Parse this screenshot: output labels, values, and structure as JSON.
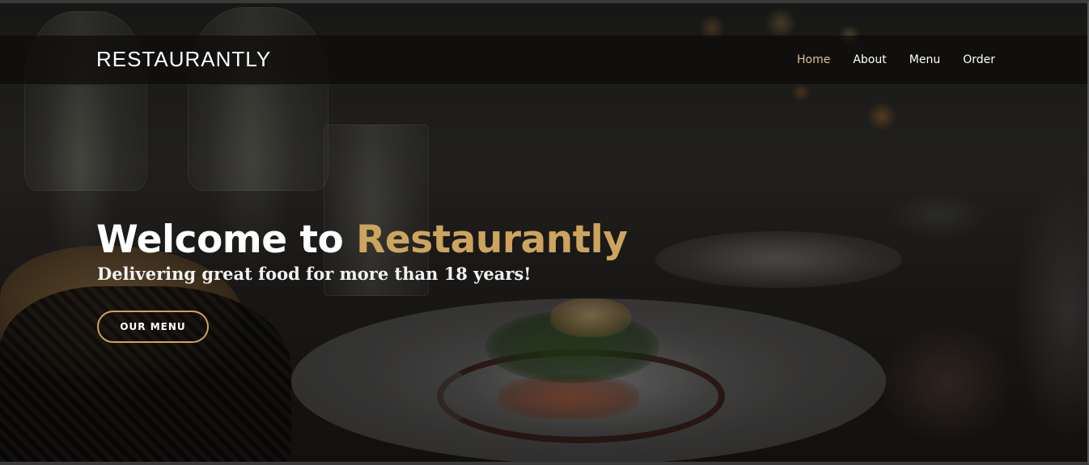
{
  "brand": {
    "name": "RESTAURANTLY"
  },
  "nav": {
    "items": [
      {
        "label": "Home",
        "active": true
      },
      {
        "label": "About",
        "active": false
      },
      {
        "label": "Menu",
        "active": false
      },
      {
        "label": "Order",
        "active": false
      }
    ]
  },
  "hero": {
    "title_prefix": "Welcome to ",
    "title_accent": "Restaurantly",
    "subtitle": "Delivering great food for more than 18 years!",
    "cta_label": "OUR MENU"
  },
  "colors": {
    "accent": "#cda45e",
    "nav_active": "#e0c08a",
    "navbar_bg": "#0c0b0a"
  }
}
